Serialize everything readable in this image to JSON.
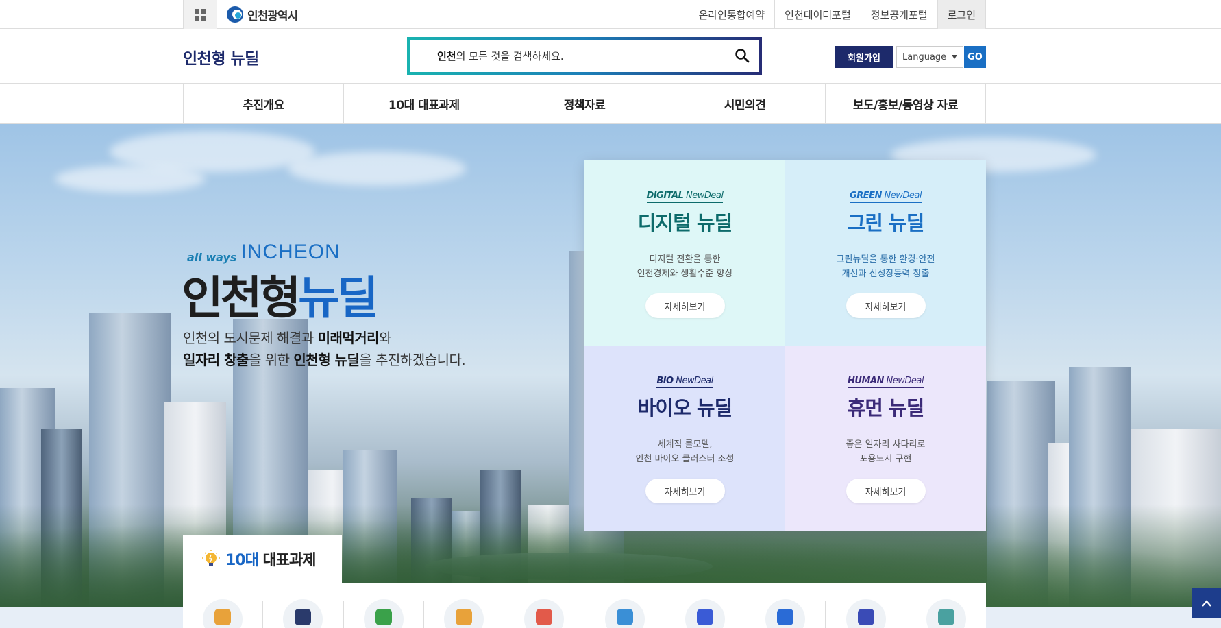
{
  "util": {
    "city_name": "인천광역시",
    "links": [
      "온라인통합예약",
      "인천데이터포털",
      "정보공개포털",
      "로그인"
    ]
  },
  "header": {
    "site_title": "인천형 뉴딜",
    "search_bold": "인천",
    "search_rest": "의 모든 것을 검색하세요.",
    "join_label": "회원가입",
    "language_label": "Language",
    "go_label": "GO"
  },
  "nav": {
    "items": [
      "추진개요",
      "10대 대표과제",
      "정책자료",
      "시민의견",
      "보도/홍보/동영상 자료"
    ]
  },
  "hero": {
    "brand_prefix": "all ways",
    "brand_name": "INCHEON",
    "title_main": "인천형",
    "title_accent": "뉴딜",
    "desc_line1_a": "인천의 도시문제 해결과 ",
    "desc_line1_b": "미래먹거리",
    "desc_line1_c": "와",
    "desc_line2_a": "일자리 창출",
    "desc_line2_b": "을 위한 ",
    "desc_line2_c": "인천형 뉴딜",
    "desc_line2_d": "을 추진하겠습니다."
  },
  "cards": [
    {
      "tag_bold": "DIGITAL",
      "tag_rest": " NewDeal",
      "name": "디지털 뉴딜",
      "desc1": "디지털 전환을 통한",
      "desc2": "인천경제와 생활수준 향상",
      "more": "자세히보기"
    },
    {
      "tag_bold": "GREEN",
      "tag_rest": " NewDeal",
      "name": "그린 뉴딜",
      "desc1": "그린뉴딜을 통한 환경·안전",
      "desc2": "개선과 신성장동력 창출",
      "more": "자세히보기"
    },
    {
      "tag_bold": "BIO",
      "tag_rest": " NewDeal",
      "name": "바이오 뉴딜",
      "desc1": "세계적 롤모델,",
      "desc2": "인천 바이오 클러스터 조성",
      "more": "자세히보기"
    },
    {
      "tag_bold": "HUMAN",
      "tag_rest": " NewDeal",
      "name": "휴먼 뉴딜",
      "desc1": "좋은 일자리 사다리로",
      "desc2": "포용도시 구현",
      "more": "자세히보기"
    }
  ],
  "tasks": {
    "title_num": "10대",
    "title_rest": " 대표과제",
    "icons": [
      "sprout-icon",
      "monitor-icon",
      "tree-icon",
      "faucet-icon",
      "house-icon",
      "plug-icon",
      "drone-icon",
      "earth-hands-icon",
      "atom-icon",
      "recycle-head-icon"
    ],
    "icon_colors": [
      "#e8a23a",
      "#2a3a6b",
      "#3aa14a",
      "#e8a23a",
      "#e25a4a",
      "#3a8fd6",
      "#3a5bd6",
      "#2a6bd6",
      "#3a4bb6",
      "#4aa1a0"
    ]
  },
  "colors": {
    "navy": "#1d2a6b",
    "blue": "#1866c5",
    "teal": "#19b3b0"
  }
}
